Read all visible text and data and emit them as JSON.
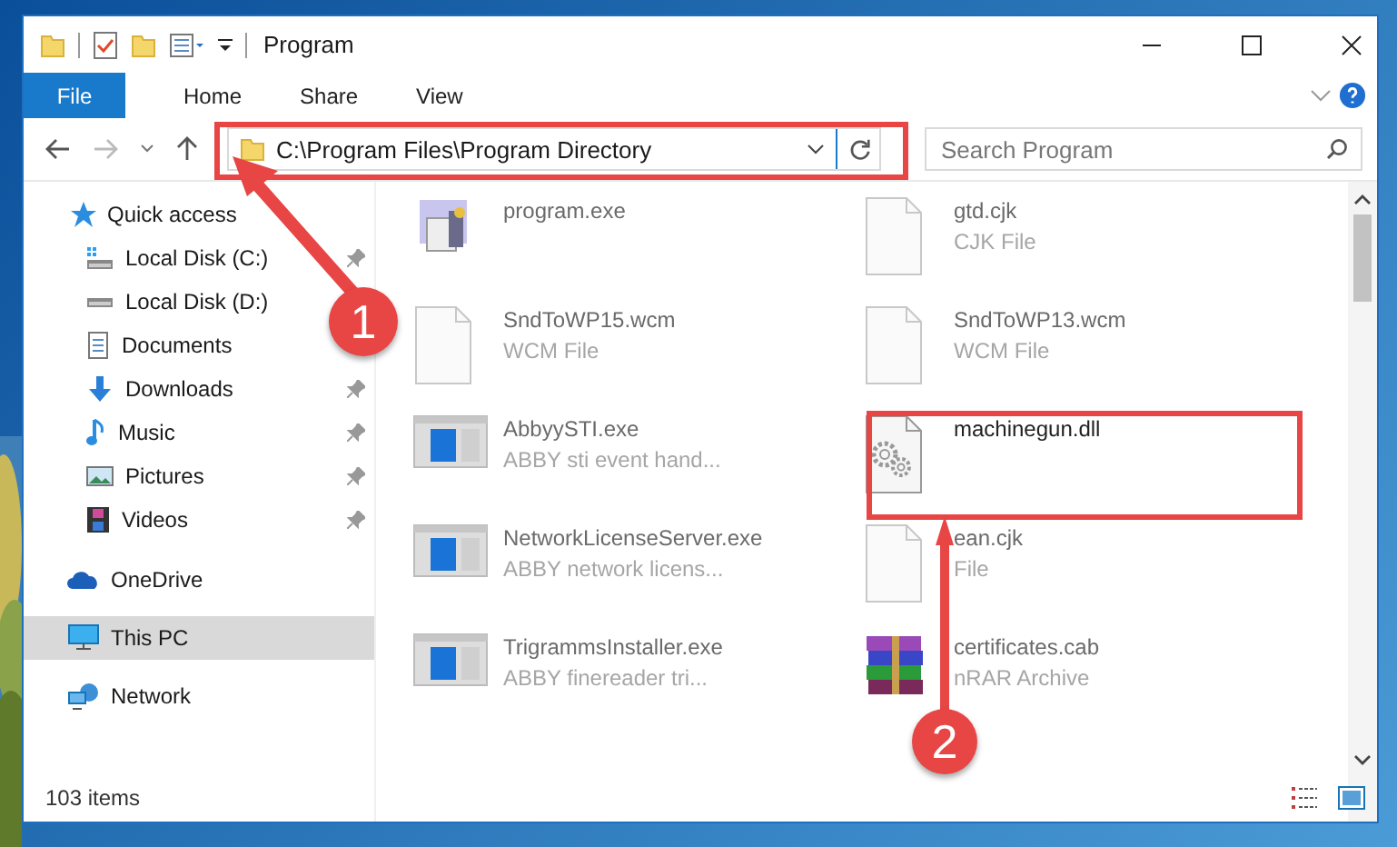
{
  "window": {
    "title": "Program"
  },
  "ribbon_tabs": [
    {
      "label": "File",
      "kind": "file"
    },
    {
      "label": "Home",
      "kind": "tab"
    },
    {
      "label": "Share",
      "kind": "tab"
    },
    {
      "label": "View",
      "kind": "tab"
    }
  ],
  "address": {
    "path": "C:\\Program Files\\Program Directory"
  },
  "search": {
    "placeholder": "Search Program"
  },
  "sidebar": {
    "items": [
      {
        "label": "Quick access",
        "kind": "star",
        "selected": false,
        "children": [
          {
            "label": "Local Disk (C:)",
            "kind": "system-drive",
            "selected": false,
            "pinned": true
          },
          {
            "label": "Local Disk (D:)",
            "kind": "drive",
            "selected": false
          },
          {
            "label": "Documents",
            "kind": "documents",
            "selected": false
          },
          {
            "label": "Downloads",
            "kind": "downloads",
            "selected": false,
            "pinned": true
          },
          {
            "label": "Music",
            "kind": "music",
            "selected": false,
            "pinned": true
          },
          {
            "label": "Pictures",
            "kind": "pictures",
            "selected": false,
            "pinned": true
          },
          {
            "label": "Videos",
            "kind": "videos",
            "selected": false,
            "pinned": true
          }
        ]
      },
      {
        "label": "OneDrive",
        "kind": "cloud",
        "selected": false
      },
      {
        "label": "This PC",
        "kind": "pc",
        "selected": true
      },
      {
        "label": "Network",
        "kind": "network",
        "selected": false
      }
    ]
  },
  "files": [
    {
      "name": "program.exe",
      "kind": "setup",
      "blurred": true
    },
    {
      "name": "gtd.cjk",
      "type": "CJK File",
      "kind": "blank",
      "blurred": true
    },
    {
      "name": "SndToWP15.wcm",
      "type": "WCM File",
      "kind": "blank",
      "blurred": true
    },
    {
      "name": "SndToWP13.wcm",
      "type": "WCM File",
      "kind": "blank",
      "blurred": true
    },
    {
      "name": "AbbyySTI.exe",
      "type": "ABBY sti event hand...",
      "kind": "app",
      "blurred": true
    },
    {
      "name": "machinegun.dll",
      "kind": "gears",
      "blurred": false
    },
    {
      "name": "NetworkLicenseServer.exe",
      "type": "ABBY network licens...",
      "kind": "app",
      "blurred": true
    },
    {
      "name": "ean.cjk",
      "type": "File",
      "kind": "blank",
      "blurred": true
    },
    {
      "name": "TrigrammsInstaller.exe",
      "type": "ABBY finereader tri...",
      "kind": "app",
      "blurred": true
    },
    {
      "name": "certificates.cab",
      "type": "nRAR Archive",
      "kind": "archive",
      "blurred": true
    }
  ],
  "status_bar": {
    "count": "103 items"
  },
  "annotations": [
    {
      "label": "1"
    },
    {
      "label": "2"
    }
  ]
}
